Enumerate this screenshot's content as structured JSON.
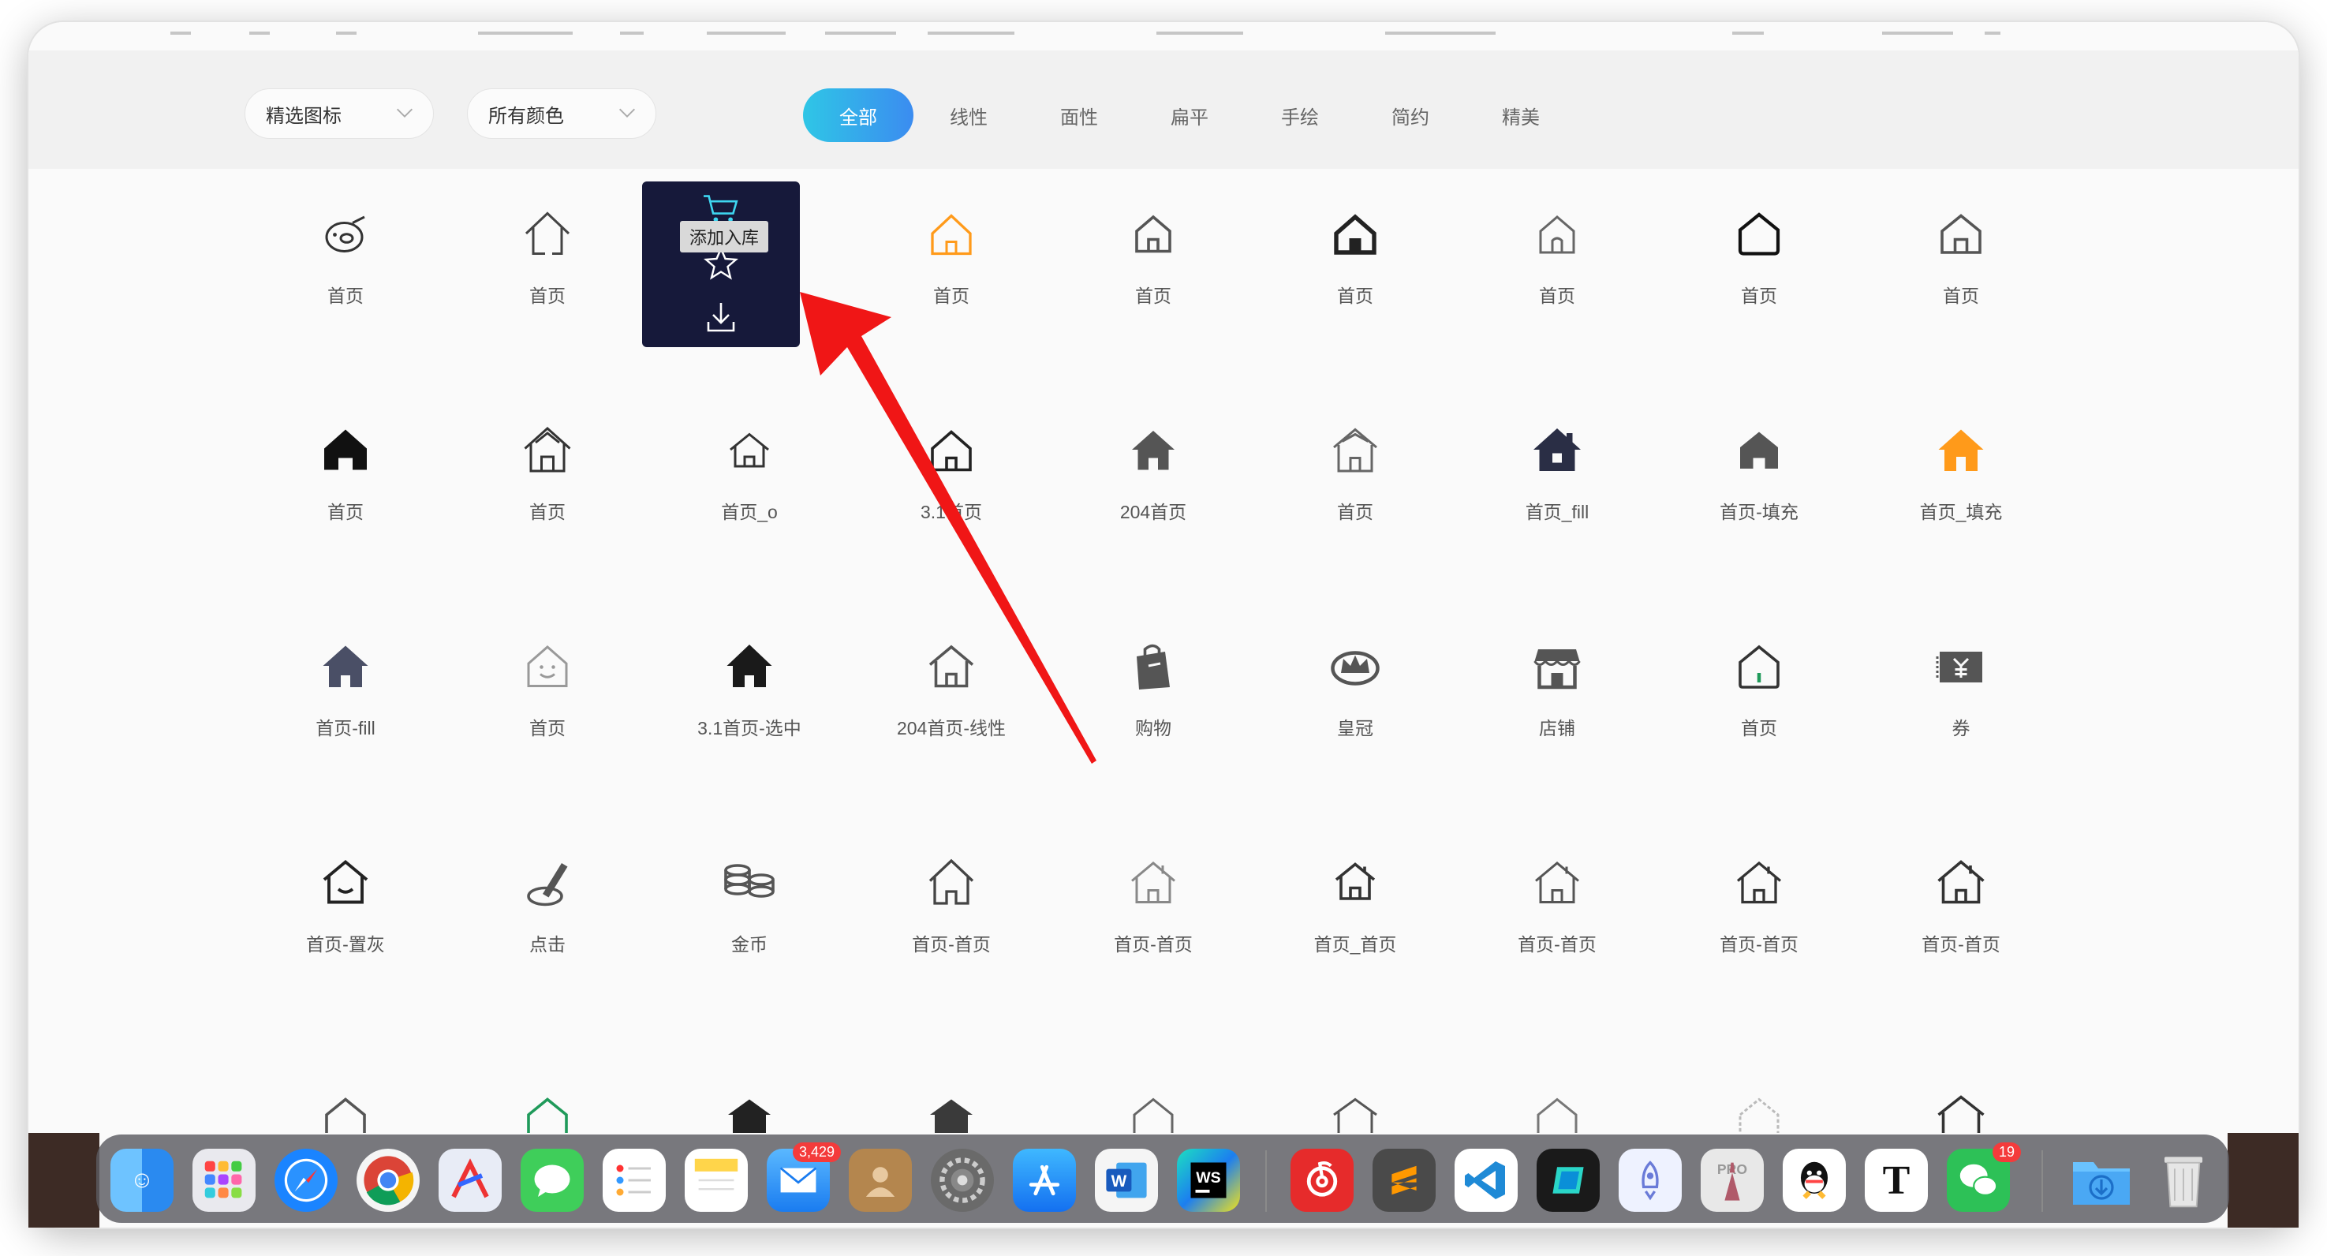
{
  "filters": {
    "dropdown_category": "精选图标",
    "dropdown_color": "所有颜色",
    "tabs": [
      "全部",
      "线性",
      "面性",
      "扁平",
      "手绘",
      "简约",
      "精美"
    ],
    "active_tab": "全部"
  },
  "hover_card": {
    "tooltip": "添加入库"
  },
  "icons": {
    "row1": [
      "首页",
      "首页",
      "",
      "首页",
      "首页",
      "首页",
      "首页",
      "首页",
      "首页"
    ],
    "row2": [
      "首页",
      "首页",
      "首页_o",
      "3.1首页",
      "204首页",
      "首页",
      "首页_fill",
      "首页-填充",
      "首页_填充"
    ],
    "row3": [
      "首页-fill",
      "首页",
      "3.1首页-选中",
      "204首页-线性",
      "购物",
      "皇冠",
      "店铺",
      "首页",
      "券"
    ],
    "row4": [
      "首页-置灰",
      "点击",
      "金币",
      "首页-首页",
      "首页-首页",
      "首页_首页",
      "首页-首页",
      "首页-首页",
      "首页-首页"
    ]
  },
  "colors": {
    "accent_start": "#2fc6e6",
    "accent_end": "#3b8cf0",
    "orange": "#ff9a1a",
    "arrow": "#f01616"
  },
  "dock": {
    "apps": [
      "finder",
      "launchpad",
      "safari",
      "chrome",
      "affinity",
      "messages",
      "reminders",
      "notes",
      "mail",
      "contacts",
      "system-preferences",
      "app-store",
      "word",
      "webstorm",
      "netease-music",
      "sublime-text",
      "vscode",
      "lens",
      "rocket",
      "pro-app",
      "qq",
      "typora",
      "wechat",
      "downloads",
      "trash"
    ],
    "mail_badge": "3,429",
    "wechat_badge": "19"
  }
}
